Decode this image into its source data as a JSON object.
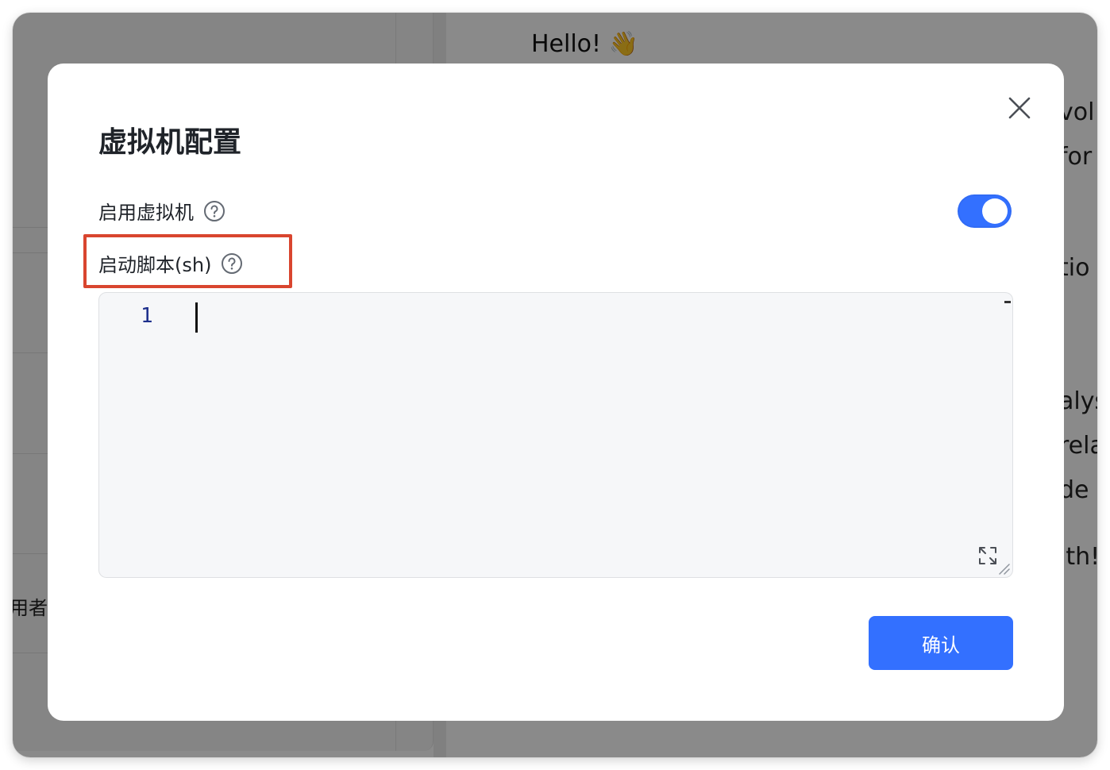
{
  "background": {
    "greeting": "Hello! 👋",
    "sidebar_text": "用者如",
    "main_fragments": [
      "vol",
      "for",
      "tio",
      "alys",
      "rela",
      "de r",
      "ith!"
    ]
  },
  "dialog": {
    "title": "虚拟机配置",
    "enable_vm": {
      "label": "启用虚拟机",
      "enabled": true
    },
    "startup_script": {
      "label": "启动脚本(sh)",
      "line_numbers": [
        "1"
      ],
      "content": ""
    },
    "confirm_label": "确认"
  },
  "colors": {
    "accent": "#3370ff",
    "highlight": "#d9452f"
  },
  "icons": {
    "close": "close-icon",
    "help": "question-circle-icon",
    "expand": "expand-icon"
  }
}
